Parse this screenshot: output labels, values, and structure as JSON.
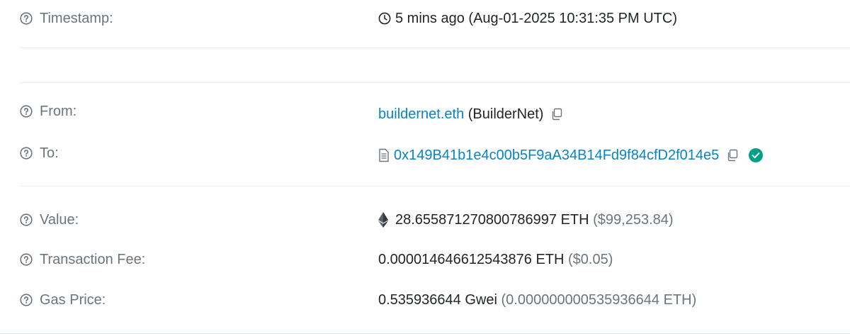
{
  "rows": {
    "timestamp": {
      "label": "Timestamp:",
      "relative": "5 mins ago",
      "absolute": "(Aug-01-2025 10:31:35 PM UTC)"
    },
    "from": {
      "label": "From:",
      "name": "buildernet.eth",
      "tag": "(BuilderNet)"
    },
    "to": {
      "label": "To:",
      "address": "0x149B41b1e4c00b5F9aA34B14Fd9f84cfD2f014e5"
    },
    "value": {
      "label": "Value:",
      "amount": "28.655871270800786997 ETH",
      "usd": "($99,253.84)"
    },
    "fee": {
      "label": "Transaction Fee:",
      "amount": "0.000014646612543876 ETH",
      "usd": "($0.05)"
    },
    "gas_price": {
      "label": "Gas Price:",
      "amount": "0.535936644 Gwei",
      "eth": "(0.000000000535936644 ETH)"
    }
  },
  "icons": {
    "help": "question-circle-icon",
    "clock": "clock-icon",
    "copy": "copy-icon",
    "contract": "document-icon",
    "verified": "check-circle-icon",
    "eth": "ethereum-icon"
  },
  "colors": {
    "link": "#0784c3",
    "muted": "#6c757d",
    "verified": "#00a186"
  }
}
